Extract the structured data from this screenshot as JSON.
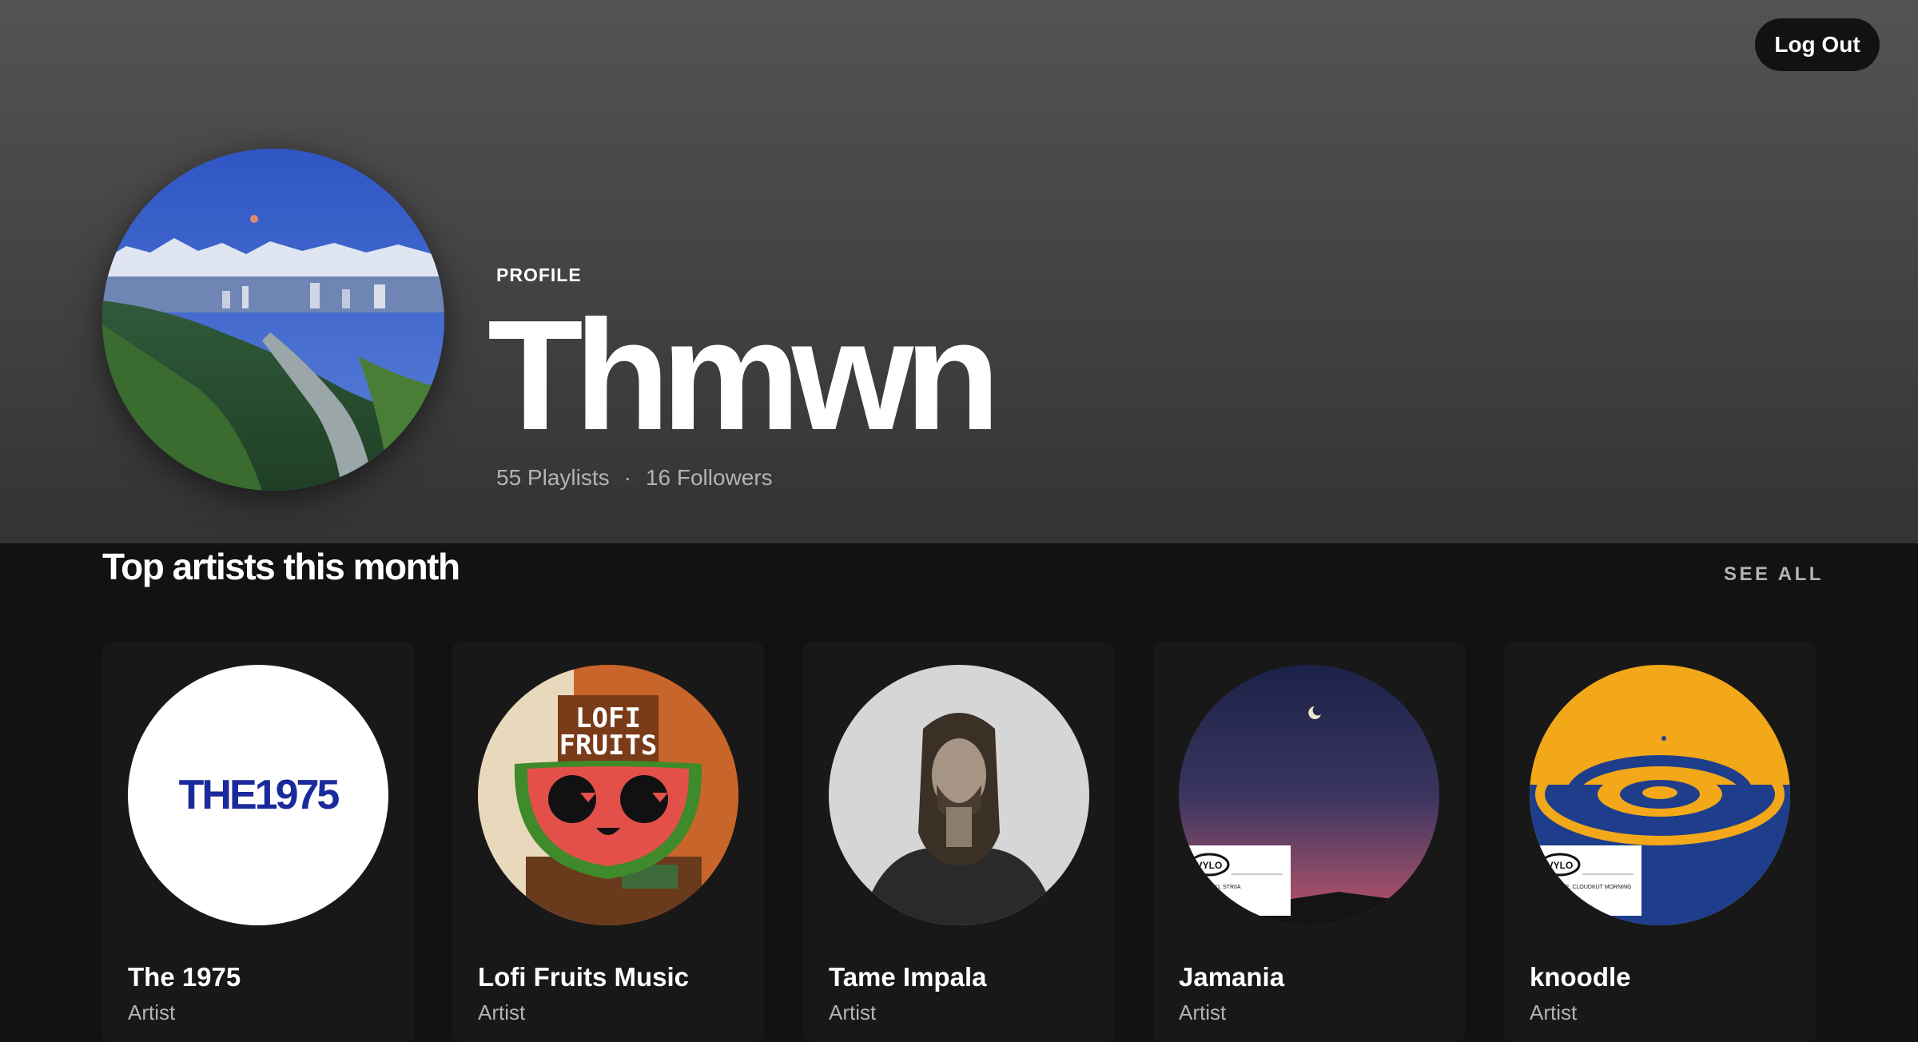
{
  "header": {
    "logout_label": "Log Out",
    "profile_label": "PROFILE",
    "name": "Thmwn",
    "playlists": "55 Playlists",
    "separator": "·",
    "followers": "16 Followers"
  },
  "top_artists": {
    "title": "Top artists this month",
    "see_all": "SEE ALL",
    "artists": [
      {
        "name": "The 1975",
        "art_text": "THE1975",
        "subtitle": "Artist"
      },
      {
        "name": "Lofi Fruits Music",
        "art_text_1": "LOFI",
        "art_text_2": "FRUITS",
        "subtitle": "Artist"
      },
      {
        "name": "Tame Impala",
        "subtitle": "Artist"
      },
      {
        "name": "Jamania",
        "art_label": "VYLO",
        "art_caption": "CHILLSKI, STRIIA",
        "subtitle": "Artist"
      },
      {
        "name": "knoodle",
        "art_label": "VYLO",
        "art_caption": "NOODLE, CLOUDKUT MORNING",
        "subtitle": "Artist"
      }
    ]
  },
  "colors": {
    "background": "#121212",
    "card": "#181818",
    "secondary_text": "#b3b3b3",
    "the1975_blue": "#1a2a9c"
  }
}
